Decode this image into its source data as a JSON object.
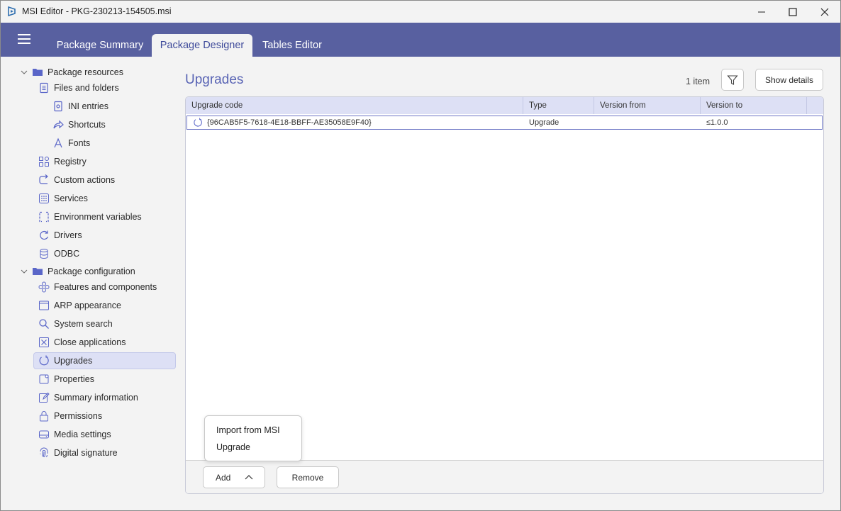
{
  "window": {
    "title": "MSI Editor - PKG-230213-154505.msi"
  },
  "tabs": [
    {
      "label": "Package Summary"
    },
    {
      "label": "Package Designer"
    },
    {
      "label": "Tables Editor"
    }
  ],
  "active_tab": "Package Designer",
  "sidebar": {
    "group1": {
      "label": "Package resources",
      "icon": "folder-icon"
    },
    "group1_items": [
      {
        "label": "Files and folders",
        "icon": "file-icon"
      },
      {
        "label": "INI entries",
        "icon": "ini-icon"
      },
      {
        "label": "Shortcuts",
        "icon": "shortcut-icon"
      },
      {
        "label": "Fonts",
        "icon": "font-icon"
      },
      {
        "label": "Registry",
        "icon": "registry-icon"
      },
      {
        "label": "Custom actions",
        "icon": "custom-action-icon"
      },
      {
        "label": "Services",
        "icon": "services-icon"
      },
      {
        "label": "Environment variables",
        "icon": "environment-icon"
      },
      {
        "label": "Drivers",
        "icon": "drivers-icon"
      },
      {
        "label": "ODBC",
        "icon": "database-icon"
      }
    ],
    "group2": {
      "label": "Package configuration",
      "icon": "folder-icon"
    },
    "group2_items": [
      {
        "label": "Features and components",
        "icon": "features-icon"
      },
      {
        "label": "ARP appearance",
        "icon": "window-icon"
      },
      {
        "label": "System search",
        "icon": "search-icon"
      },
      {
        "label": "Close applications",
        "icon": "close-box-icon"
      },
      {
        "label": "Upgrades",
        "icon": "refresh-icon"
      },
      {
        "label": "Properties",
        "icon": "properties-icon"
      },
      {
        "label": "Summary information",
        "icon": "edit-icon"
      },
      {
        "label": "Permissions",
        "icon": "lock-icon"
      },
      {
        "label": "Media settings",
        "icon": "disk-icon"
      },
      {
        "label": "Digital signature",
        "icon": "fingerprint-icon"
      }
    ],
    "selected": "Upgrades"
  },
  "main": {
    "title": "Upgrades",
    "item_count": "1 item",
    "show_details_label": "Show details",
    "columns": [
      "Upgrade code",
      "Type",
      "Version from",
      "Version to"
    ],
    "rows": [
      {
        "upgrade_code": "{96CAB5F5-7618-4E18-BBFF-AE35058E9F40}",
        "type": "Upgrade",
        "version_from": "",
        "version_to": "≤1.0.0"
      }
    ],
    "add_label": "Add",
    "remove_label": "Remove",
    "add_menu": [
      "Import from MSI",
      "Upgrade"
    ]
  },
  "colors": {
    "accent": "#5860a0",
    "title_color": "#5863b4",
    "selection": "#dde0f5"
  }
}
